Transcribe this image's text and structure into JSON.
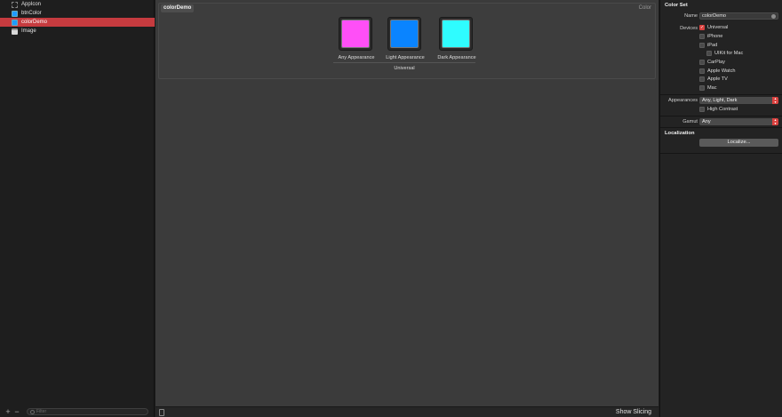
{
  "navigator": {
    "items": [
      {
        "label": "AppIcon",
        "icon": "app-icon-set-icon"
      },
      {
        "label": "btnColor",
        "icon": "color-set-icon"
      },
      {
        "label": "colorDemo",
        "icon": "color-set-icon",
        "selected": true
      },
      {
        "label": "Image",
        "icon": "image-set-icon"
      }
    ],
    "add_label": "+",
    "remove_label": "−",
    "filter_placeholder": "Filter"
  },
  "editor": {
    "title": "colorDemo",
    "type_label": "Color",
    "swatches": [
      {
        "label": "Any Appearance",
        "color": "#ff4ff7"
      },
      {
        "label": "Light Appearance",
        "color": "#0a84ff"
      },
      {
        "label": "Dark Appearance",
        "color": "#2ffcff"
      }
    ],
    "group_label": "Universal",
    "show_slicing_label": "Show Slicing"
  },
  "inspector": {
    "section_title": "Color Set",
    "name_label": "Name",
    "name_value": "colorDemo",
    "devices_label": "Devices",
    "devices": [
      {
        "label": "Universal",
        "checked": true
      },
      {
        "label": "iPhone",
        "checked": false
      },
      {
        "label": "iPad",
        "checked": false
      },
      {
        "label": "UIKit for Mac",
        "checked": false
      },
      {
        "label": "CarPlay",
        "checked": false
      },
      {
        "label": "Apple Watch",
        "checked": false
      },
      {
        "label": "Apple TV",
        "checked": false
      },
      {
        "label": "Mac",
        "checked": false
      }
    ],
    "appearances_label": "Appearances",
    "appearances_value": "Any, Light, Dark",
    "high_contrast_label": "High Contrast",
    "gamut_label": "Gamut",
    "gamut_value": "Any",
    "localization_title": "Localization",
    "localize_button": "Localize..."
  },
  "colors": {
    "selection": "#c63b3f",
    "accent": "#d9413f"
  }
}
